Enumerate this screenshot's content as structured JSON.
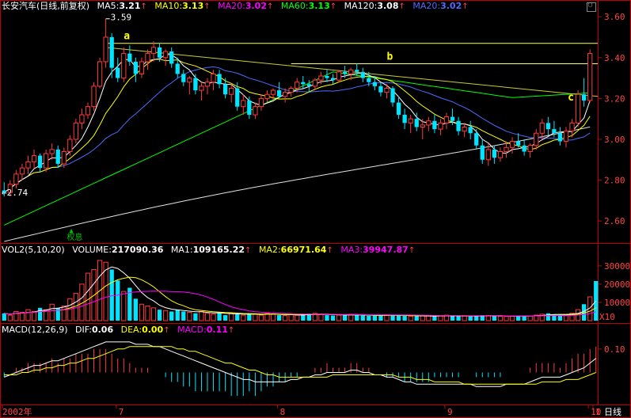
{
  "chart_data": [
    {
      "type": "candlestick",
      "title": "长安汽车(日线,前复权)",
      "indicators": [
        {
          "name": "MA5",
          "value": "3.21",
          "color": "#ffffff"
        },
        {
          "name": "MA10",
          "value": "3.13",
          "color": "#ffff00"
        },
        {
          "name": "MA20",
          "value": "3.02",
          "color": "#ff00ff"
        },
        {
          "name": "MA60",
          "value": "3.13",
          "color": "#00ff00"
        },
        {
          "name": "MA120",
          "value": "3.08",
          "color": "#ffffff"
        },
        {
          "name": "MA20",
          "value": "3.02",
          "color": "#4d6bff"
        }
      ],
      "ylim": [
        2.5,
        3.62
      ],
      "yticks": [
        "3.60",
        "3.40",
        "3.20",
        "3.00",
        "2.80",
        "2.60"
      ],
      "annotations": {
        "high": "3.59",
        "low": "2.74",
        "marks": [
          "a",
          "b",
          "c"
        ],
        "note": "权息"
      },
      "candles": [
        [
          2.75,
          2.79,
          2.72,
          2.74
        ],
        [
          2.74,
          2.8,
          2.72,
          2.78
        ],
        [
          2.78,
          2.85,
          2.76,
          2.83
        ],
        [
          2.83,
          2.88,
          2.8,
          2.86
        ],
        [
          2.86,
          2.92,
          2.83,
          2.89
        ],
        [
          2.89,
          2.95,
          2.86,
          2.92
        ],
        [
          2.92,
          2.93,
          2.84,
          2.86
        ],
        [
          2.86,
          2.95,
          2.84,
          2.93
        ],
        [
          2.93,
          2.98,
          2.9,
          2.95
        ],
        [
          2.95,
          2.97,
          2.86,
          2.88
        ],
        [
          2.88,
          2.96,
          2.86,
          2.94
        ],
        [
          2.94,
          3.02,
          2.92,
          3.0
        ],
        [
          3.0,
          3.1,
          2.98,
          3.08
        ],
        [
          3.08,
          3.15,
          3.05,
          3.12
        ],
        [
          3.12,
          3.18,
          3.1,
          3.16
        ],
        [
          3.16,
          3.28,
          3.14,
          3.26
        ],
        [
          3.26,
          3.4,
          3.25,
          3.38
        ],
        [
          3.38,
          3.59,
          3.35,
          3.5
        ],
        [
          3.5,
          3.52,
          3.3,
          3.35
        ],
        [
          3.35,
          3.4,
          3.28,
          3.3
        ],
        [
          3.3,
          3.45,
          3.28,
          3.42
        ],
        [
          3.42,
          3.46,
          3.36,
          3.38
        ],
        [
          3.38,
          3.4,
          3.28,
          3.32
        ],
        [
          3.32,
          3.4,
          3.3,
          3.38
        ],
        [
          3.38,
          3.44,
          3.34,
          3.42
        ],
        [
          3.42,
          3.48,
          3.38,
          3.45
        ],
        [
          3.45,
          3.47,
          3.38,
          3.4
        ],
        [
          3.4,
          3.44,
          3.36,
          3.43
        ],
        [
          3.43,
          3.45,
          3.35,
          3.37
        ],
        [
          3.37,
          3.4,
          3.3,
          3.32
        ],
        [
          3.32,
          3.34,
          3.26,
          3.28
        ],
        [
          3.28,
          3.31,
          3.22,
          3.3
        ],
        [
          3.3,
          3.32,
          3.22,
          3.24
        ],
        [
          3.24,
          3.28,
          3.19,
          3.26
        ],
        [
          3.26,
          3.3,
          3.22,
          3.28
        ],
        [
          3.28,
          3.34,
          3.24,
          3.32
        ],
        [
          3.32,
          3.34,
          3.25,
          3.27
        ],
        [
          3.27,
          3.3,
          3.2,
          3.22
        ],
        [
          3.22,
          3.27,
          3.18,
          3.25
        ],
        [
          3.25,
          3.28,
          3.14,
          3.16
        ],
        [
          3.16,
          3.22,
          3.12,
          3.19
        ],
        [
          3.19,
          3.21,
          3.1,
          3.12
        ],
        [
          3.12,
          3.18,
          3.1,
          3.16
        ],
        [
          3.16,
          3.22,
          3.14,
          3.2
        ],
        [
          3.2,
          3.24,
          3.18,
          3.22
        ],
        [
          3.22,
          3.25,
          3.19,
          3.24
        ],
        [
          3.24,
          3.28,
          3.2,
          3.21
        ],
        [
          3.21,
          3.25,
          3.18,
          3.23
        ],
        [
          3.23,
          3.26,
          3.21,
          3.25
        ],
        [
          3.25,
          3.3,
          3.23,
          3.28
        ],
        [
          3.28,
          3.31,
          3.25,
          3.27
        ],
        [
          3.27,
          3.29,
          3.23,
          3.26
        ],
        [
          3.26,
          3.3,
          3.24,
          3.29
        ],
        [
          3.29,
          3.33,
          3.27,
          3.31
        ],
        [
          3.31,
          3.34,
          3.28,
          3.3
        ],
        [
          3.3,
          3.32,
          3.27,
          3.29
        ],
        [
          3.29,
          3.34,
          3.28,
          3.33
        ],
        [
          3.33,
          3.36,
          3.3,
          3.32
        ],
        [
          3.32,
          3.35,
          3.29,
          3.34
        ],
        [
          3.34,
          3.37,
          3.31,
          3.33
        ],
        [
          3.33,
          3.35,
          3.28,
          3.3
        ],
        [
          3.3,
          3.33,
          3.26,
          3.28
        ],
        [
          3.28,
          3.31,
          3.24,
          3.26
        ],
        [
          3.26,
          3.28,
          3.21,
          3.23
        ],
        [
          3.23,
          3.27,
          3.2,
          3.25
        ],
        [
          3.25,
          3.26,
          3.16,
          3.18
        ],
        [
          3.18,
          3.21,
          3.1,
          3.12
        ],
        [
          3.12,
          3.15,
          3.05,
          3.08
        ],
        [
          3.08,
          3.12,
          3.03,
          3.1
        ],
        [
          3.1,
          3.13,
          3.04,
          3.06
        ],
        [
          3.06,
          3.1,
          3.0,
          3.07
        ],
        [
          3.07,
          3.11,
          3.04,
          3.09
        ],
        [
          3.09,
          3.12,
          3.03,
          3.05
        ],
        [
          3.05,
          3.1,
          3.02,
          3.08
        ],
        [
          3.08,
          3.13,
          3.05,
          3.11
        ],
        [
          3.11,
          3.15,
          3.07,
          3.09
        ],
        [
          3.09,
          3.11,
          3.02,
          3.04
        ],
        [
          3.04,
          3.08,
          3.01,
          3.06
        ],
        [
          3.06,
          3.09,
          3.0,
          3.03
        ],
        [
          3.03,
          3.05,
          2.95,
          2.97
        ],
        [
          2.97,
          3.0,
          2.88,
          2.9
        ],
        [
          2.9,
          2.98,
          2.87,
          2.95
        ],
        [
          2.95,
          2.97,
          2.88,
          2.91
        ],
        [
          2.91,
          2.96,
          2.89,
          2.94
        ],
        [
          2.94,
          2.99,
          2.91,
          2.96
        ],
        [
          2.96,
          3.01,
          2.93,
          2.99
        ],
        [
          2.99,
          3.03,
          2.96,
          2.97
        ],
        [
          2.97,
          3.0,
          2.92,
          2.94
        ],
        [
          2.94,
          2.98,
          2.91,
          2.97
        ],
        [
          2.97,
          3.05,
          2.95,
          3.03
        ],
        [
          3.03,
          3.1,
          3.0,
          3.08
        ],
        [
          3.08,
          3.11,
          3.02,
          3.05
        ],
        [
          3.05,
          3.09,
          3.01,
          3.03
        ],
        [
          3.03,
          3.06,
          2.97,
          2.99
        ],
        [
          2.99,
          3.06,
          2.96,
          3.04
        ],
        [
          3.04,
          3.1,
          3.01,
          3.08
        ],
        [
          3.08,
          3.24,
          3.06,
          3.22
        ],
        [
          3.22,
          3.3,
          3.16,
          3.19
        ],
        [
          3.19,
          3.44,
          3.18,
          3.42
        ]
      ],
      "trendlines": [
        {
          "from": [
            17,
            3.47
          ],
          "to": [
            100,
            3.47
          ],
          "color": "#ffff66"
        },
        {
          "from": [
            17,
            3.45
          ],
          "to": [
            100,
            3.21
          ],
          "color": "#cccc33"
        },
        {
          "from": [
            48,
            3.37
          ],
          "to": [
            100,
            3.37
          ],
          "color": "#ffff66"
        }
      ]
    },
    {
      "type": "bar",
      "title": "VOL2(5,10,20)",
      "indicators": [
        {
          "name": "VOLUME",
          "value": "217090.36",
          "color": "#ffffff"
        },
        {
          "name": "MA1",
          "value": "109165.22",
          "color": "#ffffff"
        },
        {
          "name": "MA2",
          "value": "66971.64",
          "color": "#ffff00"
        },
        {
          "name": "MA3",
          "value": "39947.87",
          "color": "#ff00ff"
        }
      ],
      "yticks": [
        "30000",
        "20000",
        "10000"
      ],
      "unit": "X10",
      "ylim": [
        0,
        36000
      ],
      "values": [
        4000,
        3000,
        5000,
        4500,
        6000,
        5000,
        7000,
        6000,
        9000,
        7000,
        8000,
        12000,
        15000,
        20000,
        26000,
        28000,
        33000,
        32000,
        28000,
        22000,
        16000,
        18000,
        12000,
        9000,
        8000,
        7000,
        6000,
        5500,
        5000,
        6000,
        5000,
        4500,
        4000,
        5000,
        4000,
        3500,
        4500,
        3000,
        4000,
        3500,
        3000,
        4000,
        3500,
        3000,
        4000,
        3500,
        3000,
        2800,
        3200,
        3000,
        3500,
        3800,
        4000,
        3500,
        3000,
        2800,
        3000,
        3200,
        3400,
        3000,
        2800,
        2600,
        2800,
        3000,
        3200,
        3000,
        2800,
        2600,
        2400,
        2500,
        2700,
        2600,
        2400,
        2800,
        3000,
        2600,
        2400,
        2500,
        2300,
        2600,
        3000,
        2800,
        2600,
        2400,
        2300,
        2500,
        2700,
        2400,
        2600,
        3000,
        3500,
        4000,
        3500,
        3200,
        3000,
        4000,
        6000,
        9000,
        13000,
        21700
      ]
    },
    {
      "type": "bar",
      "title": "MACD(12,26,9)",
      "indicators": [
        {
          "name": "DIF",
          "value": "0.06",
          "color": "#ffffff"
        },
        {
          "name": "DEA",
          "value": "0.00",
          "color": "#ffff00"
        },
        {
          "name": "MACD",
          "value": "0.11",
          "color": "#ff00ff"
        }
      ],
      "yticks": [
        "0.10"
      ],
      "ylim": [
        -0.16,
        0.16
      ],
      "dif": [
        -0.02,
        -0.01,
        0.0,
        0.01,
        0.02,
        0.03,
        0.03,
        0.04,
        0.05,
        0.05,
        0.06,
        0.07,
        0.08,
        0.09,
        0.1,
        0.11,
        0.12,
        0.13,
        0.13,
        0.13,
        0.13,
        0.13,
        0.12,
        0.12,
        0.12,
        0.11,
        0.11,
        0.1,
        0.09,
        0.08,
        0.07,
        0.06,
        0.05,
        0.04,
        0.03,
        0.02,
        0.01,
        0.0,
        -0.01,
        -0.02,
        -0.03,
        -0.03,
        -0.04,
        -0.04,
        -0.04,
        -0.04,
        -0.04,
        -0.04,
        -0.03,
        -0.03,
        -0.02,
        -0.02,
        -0.01,
        -0.01,
        0.0,
        0.0,
        0.0,
        0.0,
        0.01,
        0.01,
        0.0,
        0.0,
        -0.01,
        -0.01,
        -0.02,
        -0.02,
        -0.03,
        -0.04,
        -0.04,
        -0.05,
        -0.05,
        -0.05,
        -0.05,
        -0.05,
        -0.05,
        -0.05,
        -0.05,
        -0.05,
        -0.05,
        -0.06,
        -0.06,
        -0.06,
        -0.06,
        -0.06,
        -0.05,
        -0.05,
        -0.05,
        -0.05,
        -0.04,
        -0.03,
        -0.02,
        -0.02,
        -0.02,
        -0.02,
        -0.01,
        0.0,
        0.01,
        0.02,
        0.04,
        0.06
      ],
      "dea": [
        -0.01,
        -0.01,
        -0.01,
        0.0,
        0.0,
        0.01,
        0.01,
        0.02,
        0.02,
        0.03,
        0.03,
        0.04,
        0.04,
        0.05,
        0.06,
        0.06,
        0.07,
        0.08,
        0.09,
        0.1,
        0.1,
        0.11,
        0.11,
        0.11,
        0.11,
        0.11,
        0.11,
        0.11,
        0.11,
        0.1,
        0.1,
        0.09,
        0.09,
        0.08,
        0.07,
        0.06,
        0.05,
        0.04,
        0.04,
        0.03,
        0.02,
        0.01,
        0.01,
        0.0,
        -0.01,
        -0.01,
        -0.02,
        -0.02,
        -0.02,
        -0.02,
        -0.02,
        -0.02,
        -0.02,
        -0.02,
        -0.02,
        -0.01,
        -0.01,
        -0.01,
        -0.01,
        -0.01,
        -0.01,
        -0.01,
        -0.01,
        -0.01,
        -0.01,
        -0.01,
        -0.02,
        -0.02,
        -0.02,
        -0.03,
        -0.03,
        -0.03,
        -0.04,
        -0.04,
        -0.04,
        -0.04,
        -0.04,
        -0.05,
        -0.05,
        -0.05,
        -0.05,
        -0.05,
        -0.05,
        -0.05,
        -0.05,
        -0.05,
        -0.05,
        -0.05,
        -0.05,
        -0.05,
        -0.04,
        -0.04,
        -0.04,
        -0.04,
        -0.03,
        -0.03,
        -0.03,
        -0.02,
        -0.01,
        0.0
      ],
      "macd": [
        -0.02,
        0.0,
        0.02,
        0.02,
        0.04,
        0.04,
        0.04,
        0.04,
        0.06,
        0.04,
        0.06,
        0.06,
        0.08,
        0.08,
        0.08,
        0.1,
        0.1,
        0.1,
        0.08,
        0.06,
        0.06,
        0.04,
        0.02,
        0.02,
        0.02,
        0.0,
        0.0,
        -0.02,
        -0.04,
        -0.04,
        -0.06,
        -0.06,
        -0.08,
        -0.08,
        -0.08,
        -0.08,
        -0.08,
        -0.08,
        -0.1,
        -0.1,
        -0.1,
        -0.08,
        -0.1,
        -0.08,
        -0.06,
        -0.06,
        -0.04,
        -0.04,
        -0.02,
        -0.02,
        0.0,
        0.0,
        0.02,
        0.02,
        0.04,
        0.02,
        0.02,
        0.02,
        0.04,
        0.04,
        0.02,
        0.02,
        0.0,
        0.0,
        -0.02,
        -0.02,
        -0.02,
        -0.04,
        -0.04,
        -0.04,
        -0.04,
        -0.04,
        -0.02,
        -0.02,
        -0.02,
        -0.02,
        -0.02,
        0.0,
        0.0,
        -0.02,
        -0.02,
        -0.02,
        -0.02,
        -0.02,
        0.0,
        0.0,
        0.0,
        0.0,
        0.02,
        0.04,
        0.04,
        0.04,
        0.04,
        0.02,
        0.04,
        0.06,
        0.08,
        0.08,
        0.1,
        0.11
      ]
    }
  ],
  "xaxis": {
    "labels": [
      "2002年",
      "7",
      "8",
      "9",
      "10",
      "1"
    ],
    "positions": [
      0,
      19,
      46,
      74,
      101,
      124
    ]
  },
  "period": "日线",
  "colors": {
    "up": "#ff3b3b",
    "down": "#00e5ff",
    "frame": "#c00000",
    "text": "#ff4444"
  }
}
